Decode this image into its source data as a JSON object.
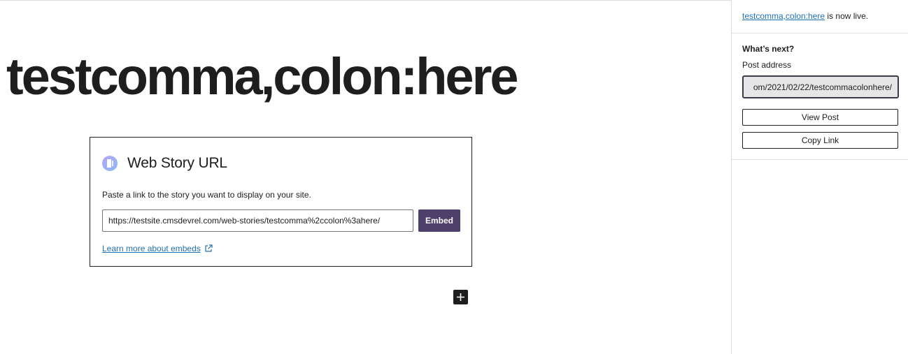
{
  "editor": {
    "post_title": "testcomma,colon:here",
    "embed_block": {
      "label": "Web Story URL",
      "icon": "web-stories-icon",
      "instructions": "Paste a link to the story you want to display on your site.",
      "url_value": "https://testsite.cmsdevrel.com/web-stories/testcomma%2ccolon%3ahere/",
      "embed_button_label": "Embed",
      "learn_more_link": "Learn more about embeds",
      "learn_more_icon": "external-link-icon",
      "accent_color": "#4f3f6b"
    },
    "inserter_icon": "plus-icon"
  },
  "sidebar": {
    "post_link_text": "testcomma,colon:here",
    "live_suffix": " is now live.",
    "whats_next_heading": "What’s next?",
    "post_address_label": "Post address",
    "post_address_value": "om/2021/02/22/testcommacolonhere/",
    "view_post_label": "View Post",
    "copy_link_label": "Copy Link",
    "link_color": "#2271b1"
  }
}
